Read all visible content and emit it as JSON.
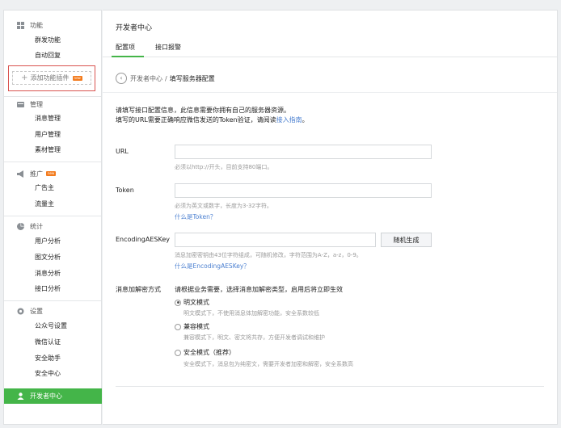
{
  "sidebar": {
    "sections": [
      {
        "title": "功能",
        "icon": "grid-icon",
        "items": [
          "群发功能",
          "自动回复"
        ]
      },
      {
        "title": "管理",
        "icon": "folder-icon",
        "items": [
          "消息管理",
          "用户管理",
          "素材管理"
        ]
      },
      {
        "title": "推广",
        "icon": "megaphone-icon",
        "badge": "new",
        "items": [
          "广告主",
          "流量主"
        ]
      },
      {
        "title": "统计",
        "icon": "pie-chart-icon",
        "items": [
          "用户分析",
          "图文分析",
          "消息分析",
          "接口分析"
        ]
      },
      {
        "title": "设置",
        "icon": "gear-icon",
        "items": [
          "公众号设置",
          "微信认证",
          "安全助手",
          "安全中心"
        ]
      }
    ],
    "add_plugin": {
      "plus": "+",
      "label": "添加功能插件",
      "badge": "new"
    },
    "active": {
      "label": "开发者中心",
      "icon": "user-icon"
    }
  },
  "header": {
    "title": "开发者中心",
    "tabs": [
      {
        "label": "配置项"
      },
      {
        "label": "接口报警"
      }
    ]
  },
  "breadcrumb": {
    "back": "‹",
    "parent": "开发者中心",
    "separator": "/",
    "current": "填写服务器配置"
  },
  "intro": {
    "line1": "请填写接口配置信息，此信息需要你拥有自己的服务器资源。",
    "line2_prefix": "填写的URL需要正确响应微信发送的Token验证，请阅读",
    "line2_link": "接入指南",
    "line2_suffix": "。"
  },
  "form": {
    "url": {
      "label": "URL",
      "value": "",
      "hint": "必须以http://开头，目前支持80端口。"
    },
    "token": {
      "label": "Token",
      "value": "",
      "hint": "必须为英文或数字，长度为3-32字符。",
      "link": "什么是Token？"
    },
    "aes": {
      "label": "EncodingAESKey",
      "value": "",
      "button": "随机生成",
      "hint": "消息加密密钥由43位字符组成，可随机修改，字符范围为A-Z，a-z，0-9。",
      "link": "什么是EncodingAESKey？"
    },
    "encrypt": {
      "label": "消息加解密方式",
      "intro": "请根据业务需要，选择消息加解密类型，启用后将立即生效",
      "options": [
        {
          "label": "明文模式",
          "desc": "明文模式下，不使用消息体加解密功能，安全系数较低",
          "checked": true
        },
        {
          "label": "兼容模式",
          "desc": "兼容模式下，明文、密文将共存，方便开发者调试和维护",
          "checked": false
        },
        {
          "label": "安全模式（推荐）",
          "desc": "安全模式下，消息包为纯密文，需要开发者加密和解密，安全系数高",
          "checked": false
        }
      ]
    }
  },
  "colors": {
    "accent": "#44b549",
    "link": "#4a7fd0",
    "highlight_box": "#d9534f",
    "badge": "#f37b1d"
  }
}
